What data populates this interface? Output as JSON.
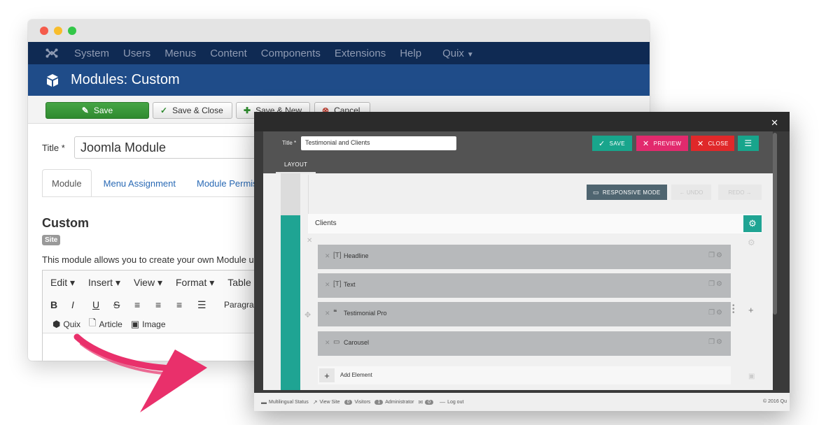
{
  "joomla": {
    "nav": [
      "System",
      "Users",
      "Menus",
      "Content",
      "Components",
      "Extensions",
      "Help",
      "Quix"
    ],
    "page_title": "Modules: Custom",
    "toolbar": {
      "save": "Save",
      "save_close": "Save & Close",
      "save_new": "Save & New",
      "cancel": "Cancel"
    },
    "title_label": "Title *",
    "title_value": "Joomla Module",
    "tabs": [
      "Module",
      "Menu Assignment",
      "Module Permis"
    ],
    "heading": "Custom",
    "badge": "Site",
    "description": "This module allows you to create your own Module u",
    "editor": {
      "menu": [
        "Edit",
        "Insert",
        "View",
        "Format",
        "Table"
      ],
      "format_buttons": [
        "B",
        "I",
        "U",
        "S"
      ],
      "paragraph": "Paragrap",
      "insert_buttons": [
        "Quix",
        "Article",
        "Image"
      ]
    }
  },
  "quix": {
    "title_label": "Title *",
    "title_value": "Testimonial and Clients",
    "buttons": {
      "save": "SAVE",
      "preview": "PREVIEW",
      "close": "CLOSE"
    },
    "tab": "LAYOUT",
    "responsive_mode": "RESPONSIVE MODE",
    "undo": "UNDO",
    "redo": "REDO",
    "section_label": "Clients",
    "elements": [
      {
        "label": "Headline",
        "icon": "[T]"
      },
      {
        "label": "Text",
        "icon": "[T]"
      },
      {
        "label": "Testimonial Pro",
        "icon": "❝"
      },
      {
        "label": "Carousel",
        "icon": "▭"
      }
    ],
    "add_element": "Add Element",
    "status": {
      "multilingual": "Multilingual Status",
      "view_site": "View Site",
      "visitors_count": "0",
      "visitors": "Visitors",
      "admin_count": "1",
      "administrator": "Administrator",
      "messages_count": "0",
      "logout": "Log out",
      "copyright": "© 2016 Qu"
    }
  },
  "colors": {
    "joomla_nav": "#0f2a53",
    "joomla_header": "#1f4c89",
    "save_green": "#46a546",
    "quix_teal": "#1fa493",
    "preview_pink": "#e22a6d",
    "close_red": "#e0282a",
    "arrow_pink": "#e9306b"
  }
}
